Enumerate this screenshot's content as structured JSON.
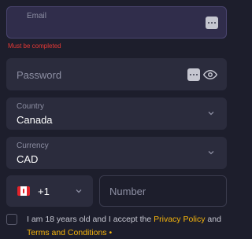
{
  "email": {
    "label": "Email",
    "error": "Must be completed"
  },
  "password": {
    "placeholder": "Password"
  },
  "country": {
    "label": "Country",
    "value": "Canada"
  },
  "currency": {
    "label": "Currency",
    "value": "CAD"
  },
  "phone": {
    "flag": "canada-flag",
    "code": "+1",
    "number_placeholder": "Number"
  },
  "terms": {
    "text_before": "I am 18 years old and I accept the ",
    "privacy_link": "Privacy Policy",
    "text_and": " and ",
    "terms_link": "Terms and Conditions",
    "required_mark": "•"
  },
  "colors": {
    "background": "#1d1e2c",
    "field": "#2b2c3d",
    "error": "#e53935",
    "accent": "#f5b40c"
  }
}
